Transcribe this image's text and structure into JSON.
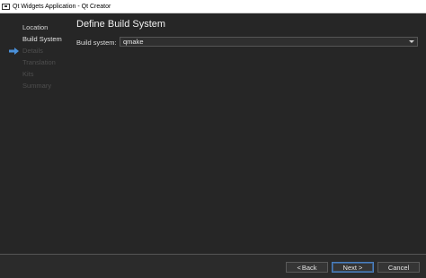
{
  "window": {
    "title": "Qt Widgets Application - Qt Creator"
  },
  "sidebar": {
    "steps": [
      {
        "label": "Location",
        "state": "done"
      },
      {
        "label": "Build System",
        "state": "current"
      },
      {
        "label": "Details",
        "state": "pending"
      },
      {
        "label": "Translation",
        "state": "pending"
      },
      {
        "label": "Kits",
        "state": "pending"
      },
      {
        "label": "Summary",
        "state": "pending"
      }
    ],
    "current_marker_icon": "right-arrow-icon"
  },
  "main": {
    "heading": "Define Build System",
    "build_system": {
      "label": "Build system:",
      "value": "qmake"
    }
  },
  "footer": {
    "back_label": "Back",
    "next_label": "Next >",
    "cancel_label": "Cancel"
  },
  "colors": {
    "accent": "#4a90d9",
    "background": "#262626",
    "pending_text": "#4e4e4e"
  }
}
